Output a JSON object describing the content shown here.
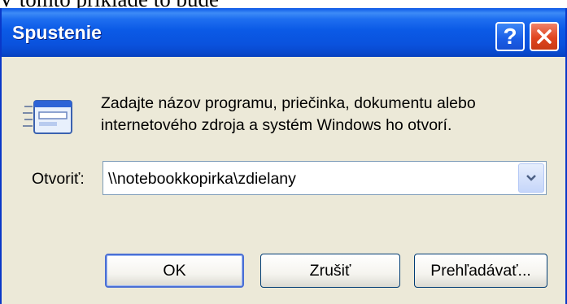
{
  "background_text": "V tomto príklade to bude",
  "dialog": {
    "title": "Spustenie",
    "description_lines": [
      "Zadajte názov programu, priečinka, dokumentu alebo",
      "internetového zdroja a systém Windows ho otvorí."
    ],
    "open_label": "Otvoriť:",
    "open_value": "\\\\notebookkopirka\\zdielany",
    "buttons": {
      "ok": "OK",
      "cancel": "Zrušiť",
      "browse": "Prehľadávať..."
    },
    "help_symbol": "?",
    "icons": {
      "run": "run-program-icon",
      "help": "help-icon",
      "close": "close-icon",
      "dropdown": "chevron-down-icon"
    }
  },
  "colors": {
    "titlebar": "#0a52dd",
    "dialog_background": "#ece9d8",
    "close_button": "#e0451f",
    "help_button": "#1a5de6"
  }
}
